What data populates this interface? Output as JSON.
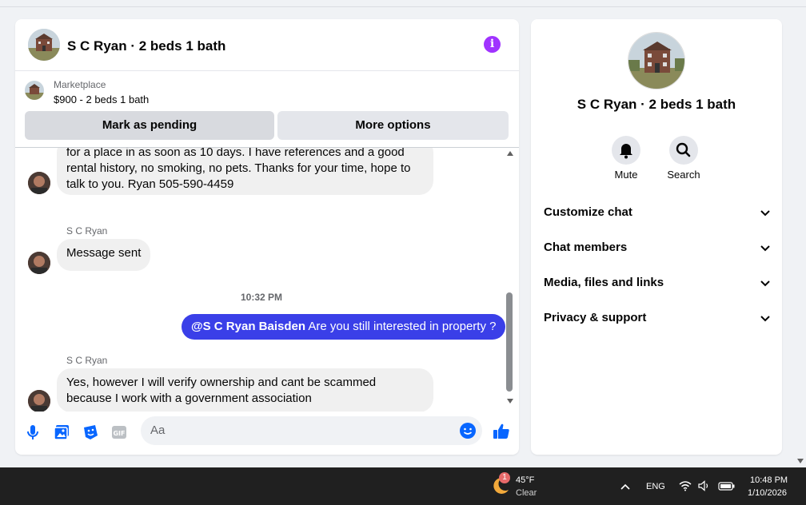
{
  "chat": {
    "title": "S C Ryan · 2 beds 1 bath",
    "marketplace": {
      "label": "Marketplace",
      "listing": "$900 - 2 beds 1 bath",
      "mark_pending_label": "Mark as pending",
      "more_options_label": "More options"
    },
    "messages": {
      "first_partial": "for a place in as soon as 10 days. I have references and a good rental history, no smoking, no pets. Thanks for your time, hope to talk to you. Ryan 505-590-4459",
      "sender_1": "S C Ryan",
      "msg_sent": "Message sent",
      "time_separator": "10:32 PM",
      "out_mention": "@S C Ryan Baisden",
      "out_text": " Are you still interested in property ?",
      "sender_2": "S C Ryan",
      "reply": "Yes, however I will verify ownership and cant be scammed because I work with a government association"
    },
    "composer": {
      "placeholder": "Aa"
    }
  },
  "info_panel": {
    "name": "S C Ryan · 2 beds 1 bath",
    "actions": [
      {
        "label": "Mute",
        "icon": "bell-icon"
      },
      {
        "label": "Search",
        "icon": "search-icon"
      }
    ],
    "sections": [
      {
        "label": "Customize chat"
      },
      {
        "label": "Chat members"
      },
      {
        "label": "Media, files and links"
      },
      {
        "label": "Privacy & support"
      }
    ]
  },
  "taskbar": {
    "weather_badge": "1",
    "temperature": "45°F",
    "condition": "Clear",
    "language": "ENG",
    "time": "10:48 PM",
    "date": "1/10/2026"
  },
  "colors": {
    "accent": "#0866ff",
    "outgoing_bubble": "#3a3fe8",
    "info_icon": "#a033ff"
  }
}
